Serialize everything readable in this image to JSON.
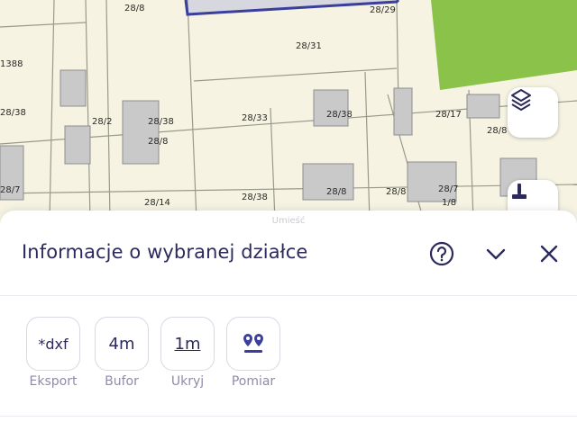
{
  "map": {
    "parcel_labels": [
      "1388",
      "28/31",
      "28/38",
      "28/2",
      "28/33",
      "28/17",
      "28/38",
      "28/38",
      "28/8",
      "28/7",
      "28/8",
      "28/7",
      "28/8",
      "28/14",
      "28/38",
      "28/29",
      "28/8",
      "28/8",
      "1/8"
    ],
    "layers_button_icon": "layers-icon",
    "measure_button_icon": "ruler-icon",
    "colors": {
      "background": "#f6f3e3",
      "green_area": "#8bc34a",
      "selected_parcel": "#3a3f9e",
      "building": "#c9c9c9"
    }
  },
  "sheet": {
    "handle_text": "Umieść",
    "title": "Informacje o wybranej działce",
    "help_icon": "help-circle-icon",
    "collapse_icon": "chevron-down-icon",
    "close_icon": "close-icon",
    "tools": [
      {
        "icon_text": "*dxf",
        "label": "Eksport"
      },
      {
        "icon_text": "4m",
        "label": "Bufor"
      },
      {
        "icon_text": "1m",
        "label": "Ukryj"
      },
      {
        "icon_text": "",
        "label": "Pomiar"
      }
    ]
  }
}
